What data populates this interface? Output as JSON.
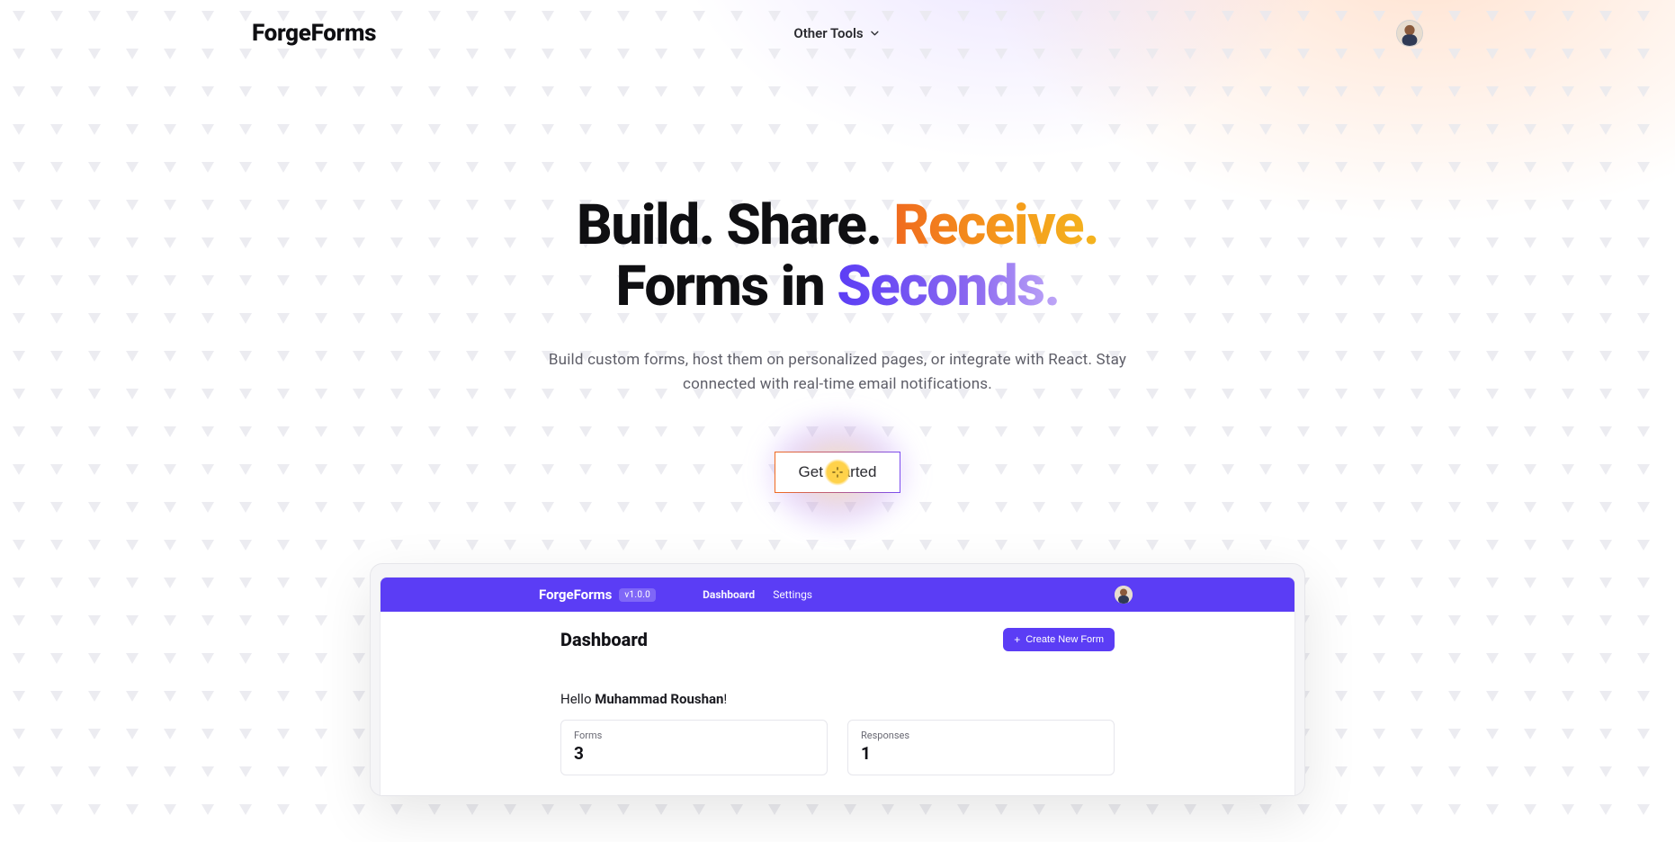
{
  "header": {
    "logo": "ForgeForms",
    "nav_item": "Other Tools"
  },
  "hero": {
    "line1_pre": "Build. Share. ",
    "line1_highlight": "Receive.",
    "line2_pre": "Forms in ",
    "line2_highlight": "Seconds.",
    "subtitle_l1": "Build custom forms, host them on personalized pages, or integrate with React. Stay",
    "subtitle_l2": "connected with real-time email notifications.",
    "cta": "Get Started"
  },
  "demo": {
    "brand": "ForgeForms",
    "badge": "v1.0.0",
    "nav": {
      "dashboard": "Dashboard",
      "settings": "Settings"
    },
    "title": "Dashboard",
    "create_btn": "Create New Form",
    "greeting_pre": "Hello ",
    "greeting_name": "Muhammad Roushan",
    "greeting_post": "!",
    "cards": {
      "forms": {
        "label": "Forms",
        "value": "3"
      },
      "responses": {
        "label": "Responses",
        "value": "1"
      }
    }
  }
}
